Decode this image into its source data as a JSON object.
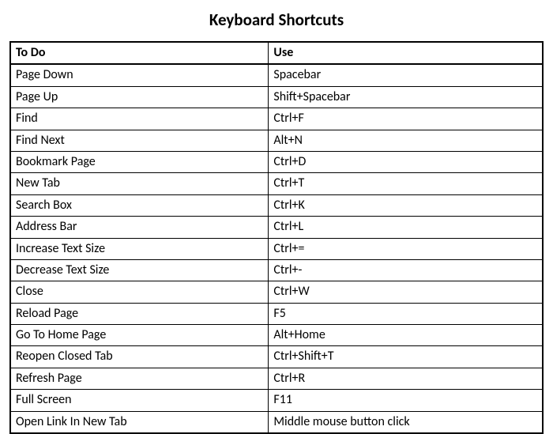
{
  "title": "Keyboard Shortcuts",
  "headers": {
    "todo": "To Do",
    "use": "Use"
  },
  "rows": [
    {
      "todo": "Page Down",
      "use": "Spacebar"
    },
    {
      "todo": "Page Up",
      "use": "Shift+Spacebar"
    },
    {
      "todo": "Find",
      "use": "Ctrl+F"
    },
    {
      "todo": "Find Next",
      "use": "Alt+N"
    },
    {
      "todo": "Bookmark Page",
      "use": "Ctrl+D"
    },
    {
      "todo": "New Tab",
      "use": "Ctrl+T"
    },
    {
      "todo": "Search Box",
      "use": "Ctrl+K"
    },
    {
      "todo": "Address Bar",
      "use": "Ctrl+L"
    },
    {
      "todo": "Increase Text Size",
      "use": "Ctrl+="
    },
    {
      "todo": "Decrease Text Size",
      "use": "Ctrl+-"
    },
    {
      "todo": "Close",
      "use": "Ctrl+W"
    },
    {
      "todo": "Reload Page",
      "use": "F5"
    },
    {
      "todo": "Go To Home Page",
      "use": "Alt+Home"
    },
    {
      "todo": "Reopen Closed Tab",
      "use": "Ctrl+Shift+T"
    },
    {
      "todo": "Refresh Page",
      "use": "Ctrl+R"
    },
    {
      "todo": "Full Screen",
      "use": "F11"
    },
    {
      "todo": "Open Link In New Tab",
      "use": "Middle mouse button click"
    }
  ]
}
